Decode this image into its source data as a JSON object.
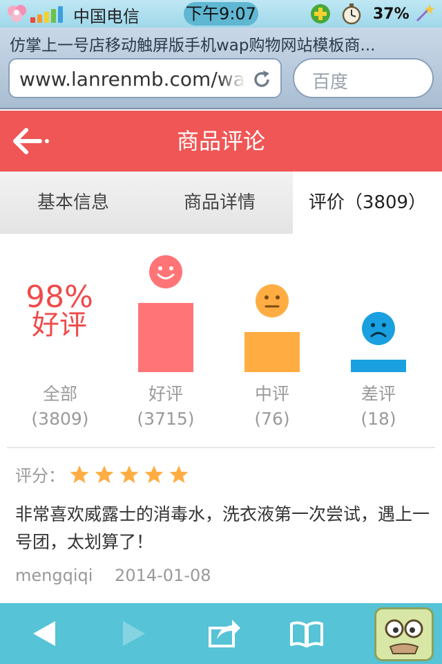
{
  "status_bar": {
    "carrier": "中国电信",
    "time": "下午9:07",
    "battery": "37%",
    "icons": [
      "flower-icon",
      "signal-icon",
      "shield-plus-icon",
      "stopwatch-icon",
      "magic-wand-icon"
    ]
  },
  "browser": {
    "page_title": "仿掌上一号店移动触屏版手机wap购物网站模板商...",
    "url": "www.lanrenmb.com/wap",
    "search_placeholder": "百度"
  },
  "header": {
    "title": "商品评论",
    "color": "#f05656"
  },
  "tabs": [
    {
      "label": "基本信息",
      "active": false
    },
    {
      "label": "商品详情",
      "active": false
    },
    {
      "label": "评价（3809）",
      "active": true
    }
  ],
  "summary": {
    "percent": "98%",
    "percent_label": "好评",
    "columns": [
      {
        "label": "全部",
        "count": "(3809)"
      },
      {
        "label": "好评",
        "count": "(3715)",
        "level": 0.66,
        "color": "#ff7577",
        "face": "smile"
      },
      {
        "label": "中评",
        "count": "(76)",
        "level": 0.38,
        "color": "#ffad42",
        "face": "neutral"
      },
      {
        "label": "差评",
        "count": "(18)",
        "level": 0.12,
        "color": "#1aa0e0",
        "face": "sad"
      }
    ]
  },
  "review": {
    "score_label": "评分：",
    "stars": 5,
    "star_color": "#ffad42",
    "text": "非常喜欢威露士的消毒水，洗衣液第一次尝试，遇上一号团，太划算了！",
    "user": "mengqiqi",
    "date": "2014-01-08"
  },
  "toolbar": {
    "buttons": [
      "back-arrow-icon",
      "forward-arrow-icon",
      "share-icon",
      "bookmarks-icon",
      "avatar"
    ]
  }
}
